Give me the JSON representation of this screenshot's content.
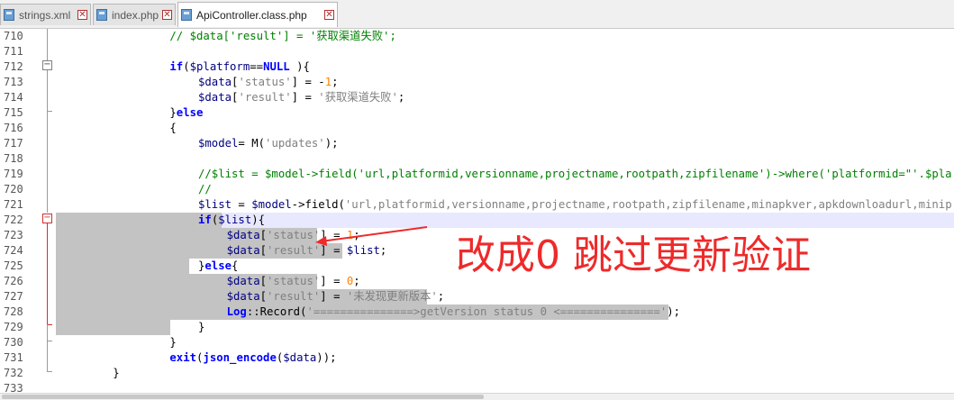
{
  "tabs": [
    {
      "label": "strings.xml",
      "active": false
    },
    {
      "label": "index.php",
      "active": false
    },
    {
      "label": "ApiController.class.php",
      "active": true
    }
  ],
  "annotation": "改成0 跳过更新验证",
  "colors": {
    "annotation": "#ee2a2a",
    "selection": "#c3c3c3",
    "keyword": "#0000ff",
    "variable": "#000080",
    "string": "#808080",
    "number": "#ff8000",
    "comment": "#008000"
  },
  "lines": [
    {
      "n": "710",
      "indent": 16,
      "tokens": [
        [
          "cm",
          "// $data['result'] = '获取渠道失败';"
        ]
      ]
    },
    {
      "n": "711",
      "indent": 0,
      "tokens": []
    },
    {
      "n": "712",
      "indent": 16,
      "tokens": [
        [
          "kw",
          "if"
        ],
        [
          "fn",
          "("
        ],
        [
          "var",
          "$platform"
        ],
        [
          "fn",
          "=="
        ],
        [
          "kw",
          "NULL"
        ],
        [
          "fn",
          " ){"
        ]
      ]
    },
    {
      "n": "713",
      "indent": 20,
      "tokens": [
        [
          "var",
          "$data"
        ],
        [
          "fn",
          "["
        ],
        [
          "str",
          "'status'"
        ],
        [
          "fn",
          "] = -"
        ],
        [
          "num",
          "1"
        ],
        [
          "fn",
          ";"
        ]
      ]
    },
    {
      "n": "714",
      "indent": 20,
      "tokens": [
        [
          "var",
          "$data"
        ],
        [
          "fn",
          "["
        ],
        [
          "str",
          "'result'"
        ],
        [
          "fn",
          "] = "
        ],
        [
          "str",
          "'获取渠道失败'"
        ],
        [
          "fn",
          ";"
        ]
      ]
    },
    {
      "n": "715",
      "indent": 16,
      "tokens": [
        [
          "fn",
          "}"
        ],
        [
          "kw",
          "else"
        ]
      ]
    },
    {
      "n": "716",
      "indent": 16,
      "tokens": [
        [
          "fn",
          "{"
        ]
      ]
    },
    {
      "n": "717",
      "indent": 20,
      "tokens": [
        [
          "var",
          "$model"
        ],
        [
          "fn",
          "= M("
        ],
        [
          "str",
          "'updates'"
        ],
        [
          "fn",
          ");"
        ]
      ]
    },
    {
      "n": "718",
      "indent": 0,
      "tokens": []
    },
    {
      "n": "719",
      "indent": 20,
      "tokens": [
        [
          "cm",
          "//$list = $model->field('url,platformid,versionname,projectname,rootpath,zipfilename')->where('platformid=\"'.$pla"
        ]
      ]
    },
    {
      "n": "720",
      "indent": 20,
      "tokens": [
        [
          "cm",
          "//"
        ]
      ]
    },
    {
      "n": "721",
      "indent": 20,
      "tokens": [
        [
          "var",
          "$list"
        ],
        [
          "fn",
          " = "
        ],
        [
          "var",
          "$model"
        ],
        [
          "fn",
          "->field("
        ],
        [
          "str",
          "'url,platformid,versionname,projectname,rootpath,zipfilename,minapkver,apkdownloadurl,minip"
        ]
      ]
    },
    {
      "n": "722",
      "indent": 20,
      "tokens": [
        [
          "kw",
          "if"
        ],
        [
          "fn",
          "("
        ],
        [
          "var",
          "$list"
        ],
        [
          "fn",
          "){"
        ]
      ]
    },
    {
      "n": "723",
      "indent": 24,
      "tokens": [
        [
          "var",
          "$data"
        ],
        [
          "fn",
          "["
        ],
        [
          "str",
          "'status'"
        ],
        [
          "fn",
          "] = "
        ],
        [
          "num",
          "1"
        ],
        [
          "fn",
          ";"
        ]
      ]
    },
    {
      "n": "724",
      "indent": 24,
      "tokens": [
        [
          "var",
          "$data"
        ],
        [
          "fn",
          "["
        ],
        [
          "str",
          "'result'"
        ],
        [
          "fn",
          "] = "
        ],
        [
          "var",
          "$list"
        ],
        [
          "fn",
          ";"
        ]
      ]
    },
    {
      "n": "725",
      "indent": 20,
      "tokens": [
        [
          "fn",
          "}"
        ],
        [
          "kw",
          "else"
        ],
        [
          "fn",
          "{"
        ]
      ]
    },
    {
      "n": "726",
      "indent": 24,
      "tokens": [
        [
          "var",
          "$data"
        ],
        [
          "fn",
          "["
        ],
        [
          "str",
          "'status'"
        ],
        [
          "fn",
          "] = "
        ],
        [
          "num",
          "0"
        ],
        [
          "fn",
          ";"
        ]
      ]
    },
    {
      "n": "727",
      "indent": 24,
      "tokens": [
        [
          "var",
          "$data"
        ],
        [
          "fn",
          "["
        ],
        [
          "str",
          "'result'"
        ],
        [
          "fn",
          "] = "
        ],
        [
          "str",
          "'未发现更新版本'"
        ],
        [
          "fn",
          ";"
        ]
      ]
    },
    {
      "n": "728",
      "indent": 24,
      "tokens": [
        [
          "kw",
          "Log"
        ],
        [
          "fn",
          "::Record("
        ],
        [
          "str",
          "'===============>getVersion status 0 <==============='"
        ],
        [
          "fn",
          ");"
        ]
      ]
    },
    {
      "n": "729",
      "indent": 20,
      "tokens": [
        [
          "fn",
          "}"
        ]
      ]
    },
    {
      "n": "730",
      "indent": 16,
      "tokens": [
        [
          "fn",
          "}"
        ]
      ]
    },
    {
      "n": "731",
      "indent": 16,
      "tokens": [
        [
          "kw",
          "exit"
        ],
        [
          "fn",
          "("
        ],
        [
          "kw",
          "json_encode"
        ],
        [
          "fn",
          "("
        ],
        [
          "var",
          "$data"
        ],
        [
          "fn",
          "));"
        ]
      ]
    },
    {
      "n": "732",
      "indent": 8,
      "tokens": [
        [
          "fn",
          "}"
        ]
      ]
    },
    {
      "n": "733",
      "indent": 0,
      "tokens": []
    }
  ]
}
